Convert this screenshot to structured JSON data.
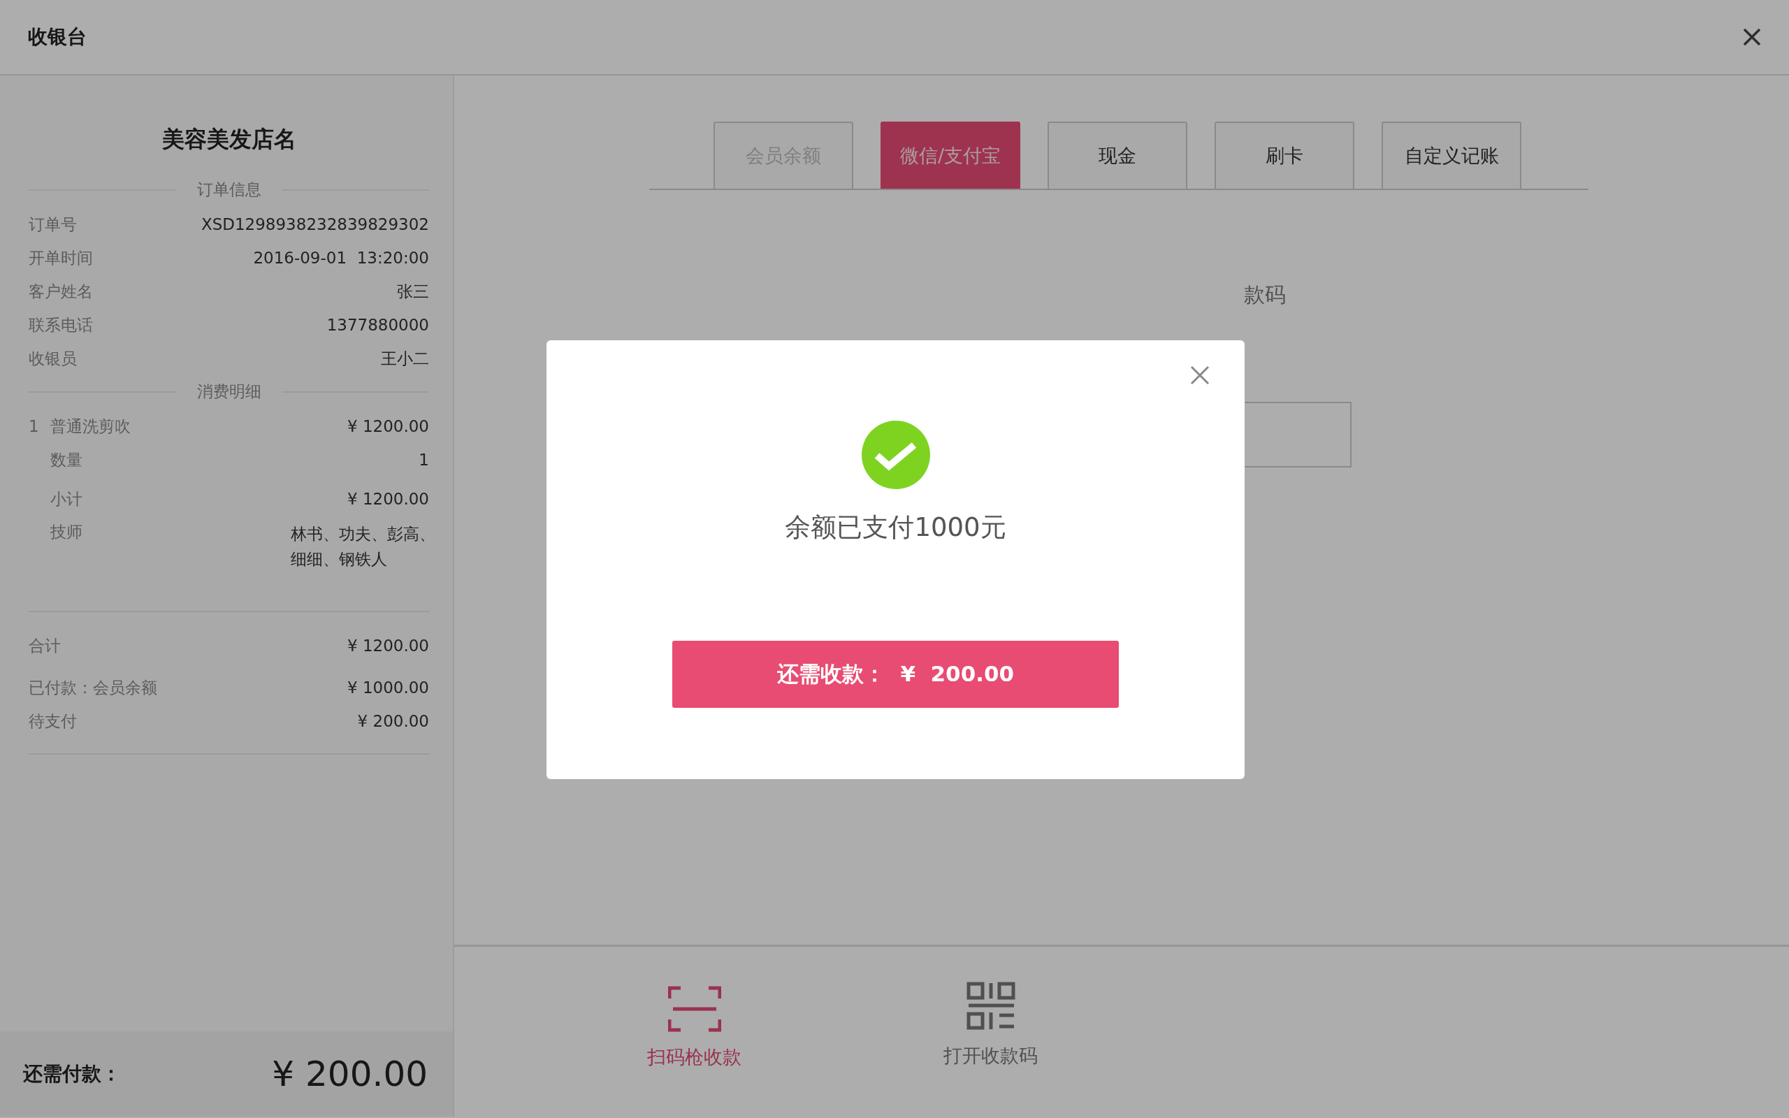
{
  "window": {
    "title": "收银台"
  },
  "receipt": {
    "shop_name": "美容美发店名",
    "order_info": {
      "title": "订单信息",
      "rows": [
        {
          "label": "订单号",
          "value": "XSD1298938232839829302"
        },
        {
          "label": "开单时间",
          "value": "2016-09-01  13:20:00"
        },
        {
          "label": "客户姓名",
          "value": "张三"
        },
        {
          "label": "联系电话",
          "value": "1377880000"
        },
        {
          "label": "收银员",
          "value": "王小二"
        }
      ]
    },
    "consumption": {
      "title": "消费明细",
      "items": [
        {
          "index": "1",
          "name": "普通洗剪吹",
          "price": "¥ 1200.00",
          "details": [
            {
              "label": "数量",
              "value": "1"
            },
            {
              "label": "小计",
              "value": "¥ 1200.00"
            },
            {
              "label": "技师",
              "value": "林书、功夫、彭高、细细、钢铁人"
            }
          ]
        }
      ]
    },
    "totals": [
      {
        "label": "合计",
        "value": "¥ 1200.00"
      },
      {
        "label": "已付款：会员余额",
        "value": "¥ 1000.00"
      },
      {
        "label": "待支付",
        "value": "¥ 200.00"
      }
    ],
    "footer": {
      "label": "还需付款：",
      "amount": "¥ 200.00"
    }
  },
  "tabs": [
    {
      "label": "会员余额",
      "selected": false,
      "disabled": true
    },
    {
      "label": "微信/支付宝",
      "selected": true,
      "disabled": false
    },
    {
      "label": "现金",
      "selected": false,
      "disabled": false
    },
    {
      "label": "刷卡",
      "selected": false,
      "disabled": false
    },
    {
      "label": "自定义记账",
      "selected": false,
      "disabled": false
    }
  ],
  "behind_text": "款码",
  "actions": [
    {
      "kind": "scan",
      "label": "扫码枪收款",
      "selected": true
    },
    {
      "kind": "qr",
      "label": "打开收款码",
      "selected": false
    }
  ],
  "modal": {
    "message": "余额已支付1000元",
    "button": "还需收款：  ¥  200.00"
  }
}
